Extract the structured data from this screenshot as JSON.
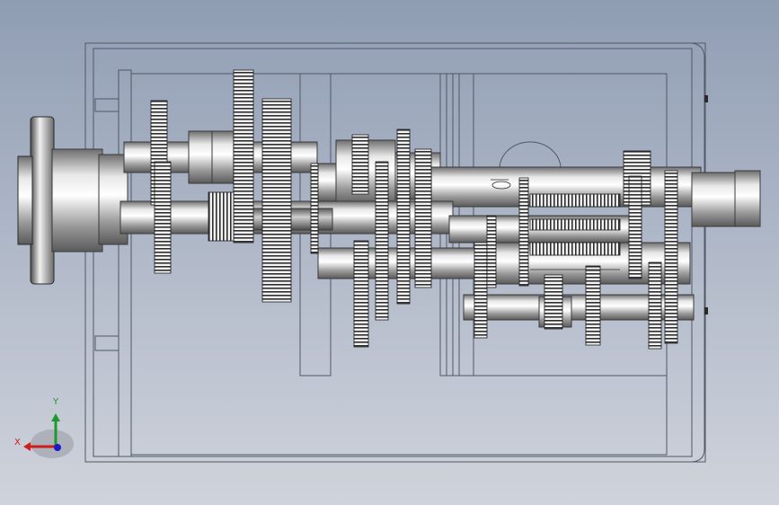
{
  "viewport": {
    "background_top": "#8f9db3",
    "background_bottom": "#cfd3db"
  },
  "triad": {
    "x_label": "X",
    "y_label": "Y",
    "x_color": "#d01c1c",
    "y_color": "#1c9a2c",
    "z_color": "#1a1ac8"
  },
  "model": {
    "style": "shaded-with-edges",
    "housing_outline_color": "#505866",
    "gear_teeth_color": "#3a3a3a"
  }
}
